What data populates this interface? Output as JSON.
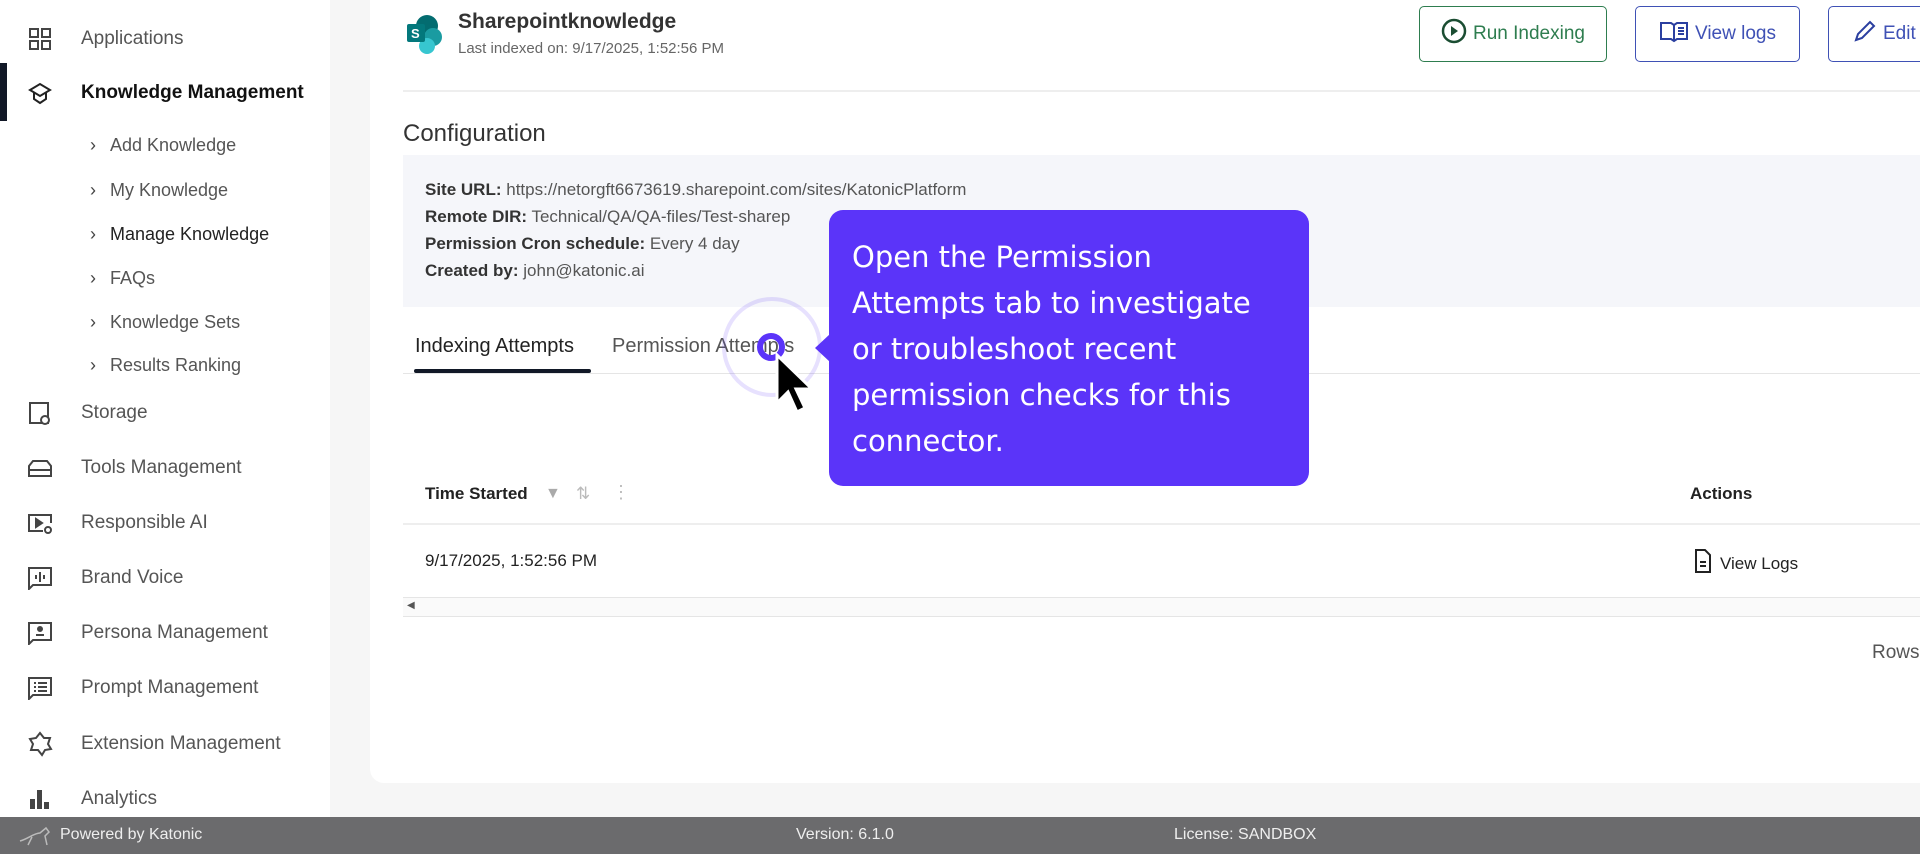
{
  "sidebar": {
    "items": [
      {
        "label": "Applications",
        "icon": "grid-icon"
      },
      {
        "label": "Knowledge Management",
        "icon": "graduation-cap-icon"
      },
      {
        "label": "Storage",
        "icon": "storage-link-icon"
      },
      {
        "label": "Tools Management",
        "icon": "toolbox-icon"
      },
      {
        "label": "Responsible AI",
        "icon": "video-settings-icon"
      },
      {
        "label": "Brand Voice",
        "icon": "voice-chat-icon"
      },
      {
        "label": "Persona Management",
        "icon": "persona-icon"
      },
      {
        "label": "Prompt Management",
        "icon": "prompt-list-icon"
      },
      {
        "label": "Extension Management",
        "icon": "puzzle-icon"
      },
      {
        "label": "Analytics",
        "icon": "bar-chart-icon"
      }
    ],
    "subitems": [
      "Add Knowledge",
      "My Knowledge",
      "Manage Knowledge",
      "FAQs",
      "Knowledge Sets",
      "Results Ranking"
    ]
  },
  "header": {
    "title": "Sharepointknowledge",
    "subtitle": "Last indexed on: 9/17/2025, 1:52:56 PM",
    "run_indexing": "Run Indexing",
    "view_logs": "View logs",
    "edit": "Edit"
  },
  "config": {
    "title": "Configuration",
    "site_url_label": "Site URL:",
    "site_url": "https://netorgft6673619.sharepoint.com/sites/KatonicPlatform",
    "remote_dir_label": "Remote DIR:",
    "remote_dir": "Technical/QA/QA-files/Test-sharep",
    "cron_label": "Permission Cron schedule:",
    "cron": "Every 4 day",
    "created_label": "Created by:",
    "created": "john@katonic.ai"
  },
  "tabs": [
    "Indexing Attempts",
    "Permission Attempts"
  ],
  "table": {
    "headers": [
      "Time Started",
      "Actions"
    ],
    "rows": [
      {
        "time": "9/17/2025, 1:52:56 PM",
        "action": "View Logs"
      }
    ],
    "pagination_label": "Rows"
  },
  "tooltip": "Open the Permission Attempts tab to investigate or troubleshoot recent permission checks for this connector.",
  "footer": {
    "powered": "Powered by Katonic",
    "version": "Version: 6.1.0",
    "license": "License: SANDBOX"
  },
  "colors": {
    "accent": "#5b34f9",
    "run": "#2e7d4f",
    "logs": "#3f51b5",
    "footer": "#6b6b6d"
  }
}
